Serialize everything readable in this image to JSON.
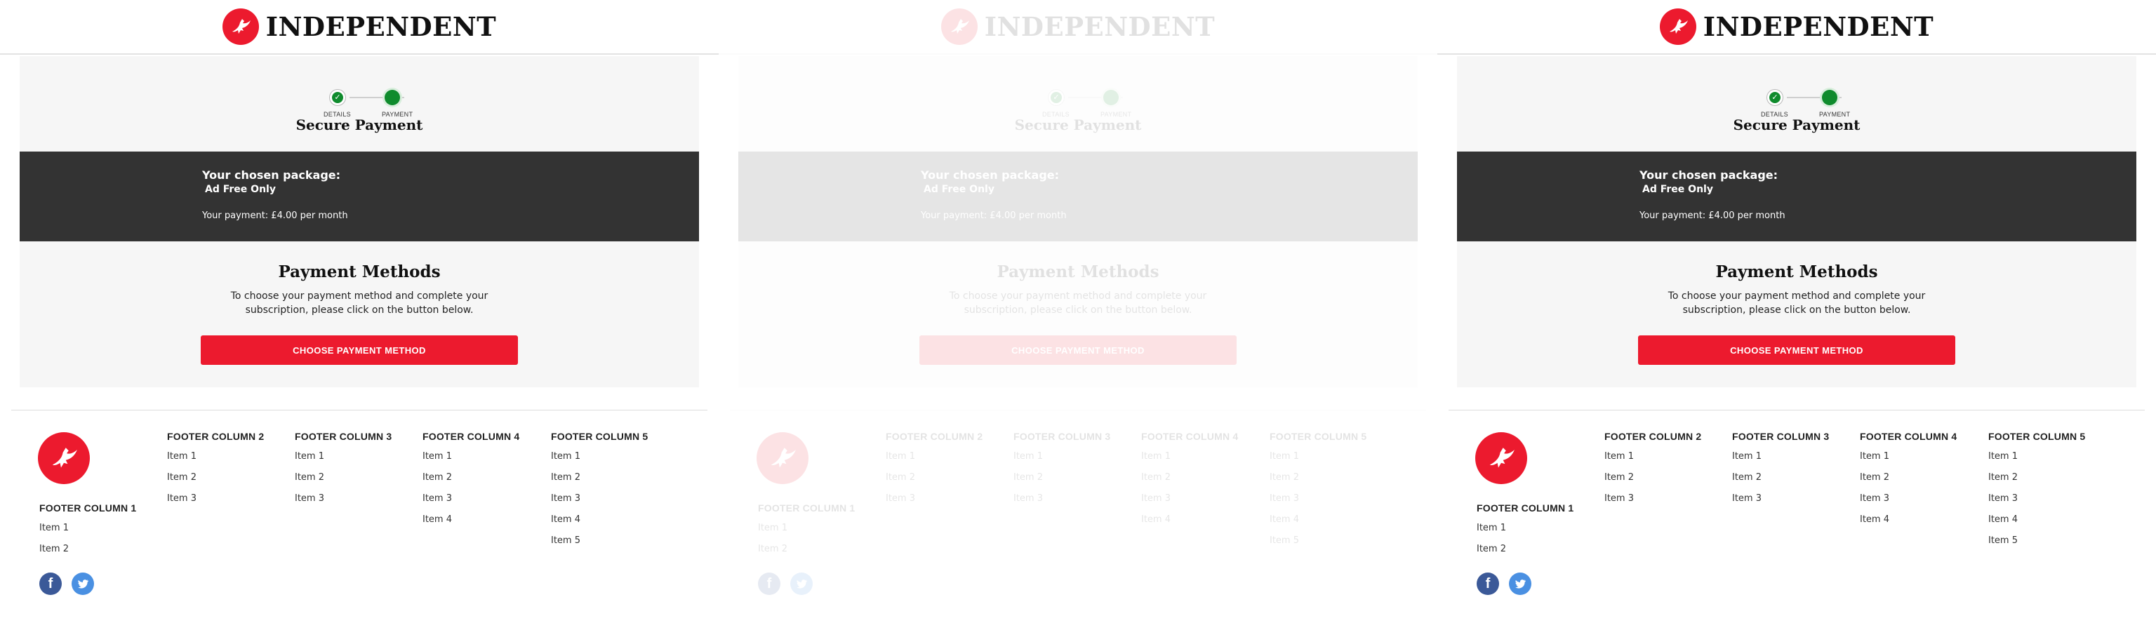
{
  "brand": {
    "name": "INDEPENDENT",
    "color": "#ec1a2e"
  },
  "stepper": {
    "steps": [
      {
        "label": "DETAILS",
        "state": "done"
      },
      {
        "label": "PAYMENT",
        "state": "current"
      }
    ],
    "accent": "#0f8b2d"
  },
  "page": {
    "title": "Secure Payment"
  },
  "package": {
    "heading": "Your chosen package:",
    "name": "Ad Free Only",
    "payment": "Your payment: £4.00 per month"
  },
  "payment_methods": {
    "title": "Payment Methods",
    "description": "To choose your payment method and complete your subscription, please click on the button below.",
    "button_label": "CHOOSE PAYMENT METHOD"
  },
  "footer": {
    "columns": [
      {
        "heading": "FOOTER COLUMN 1",
        "items": [
          "Item 1",
          "Item 2"
        ]
      },
      {
        "heading": "FOOTER COLUMN 2",
        "items": [
          "Item 1",
          "Item 2",
          "Item 3"
        ]
      },
      {
        "heading": "FOOTER COLUMN 3",
        "items": [
          "Item 1",
          "Item 2",
          "Item 3"
        ]
      },
      {
        "heading": "FOOTER COLUMN 4",
        "items": [
          "Item 1",
          "Item 2",
          "Item 3",
          "Item 4"
        ]
      },
      {
        "heading": "FOOTER COLUMN 5",
        "items": [
          "Item 1",
          "Item 2",
          "Item 3",
          "Item 4",
          "Item 5"
        ]
      }
    ],
    "social": [
      {
        "icon": "facebook-icon",
        "glyph": "f",
        "color": "#3b5998"
      },
      {
        "icon": "twitter-icon",
        "glyph": "",
        "color": "#4a90e2"
      }
    ]
  },
  "panels": [
    {
      "state": "active"
    },
    {
      "state": "faded"
    },
    {
      "state": "active"
    }
  ]
}
